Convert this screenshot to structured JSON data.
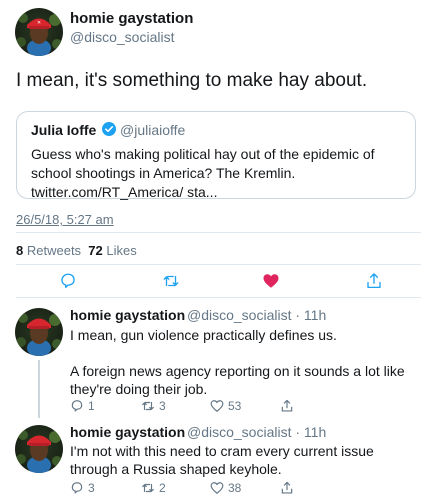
{
  "main_tweet": {
    "author_name": "homie gaystation",
    "handle": "@disco_socialist",
    "text": "I mean, it's something to make hay about.",
    "quote": {
      "author_name": "Julia Ioffe",
      "handle": "@juliaioffe",
      "text": "Guess who's making political hay out of the epidemic of school shootings in America? The Kremlin. twitter.com/RT_America/ sta..."
    },
    "timestamp": "26/5/18, 5:27 am",
    "retweet_count": "8",
    "retweet_label": "Retweets",
    "like_count": "72",
    "like_label": "Likes"
  },
  "actions": {
    "reply_icon": "reply-icon",
    "retweet_icon": "retweet-icon",
    "like_icon": "heart-icon",
    "share_icon": "share-icon",
    "liked_color": "#e0245e",
    "muted_color": "#657786"
  },
  "replies": [
    {
      "author_name": "homie gaystation",
      "handle_time": "@disco_socialist · 11h",
      "text_1": "I mean, gun violence practically defines us.",
      "text_2": "A foreign news agency reporting on it sounds a lot like they're doing their job.",
      "reply_count": "1",
      "retweet_count": "3",
      "like_count": "53"
    },
    {
      "author_name": "homie gaystation",
      "handle_time": "@disco_socialist · 11h",
      "text_1": "I'm not with this need to cram every current issue through a Russia shaped keyhole.",
      "reply_count": "3",
      "retweet_count": "2",
      "like_count": "38"
    }
  ]
}
